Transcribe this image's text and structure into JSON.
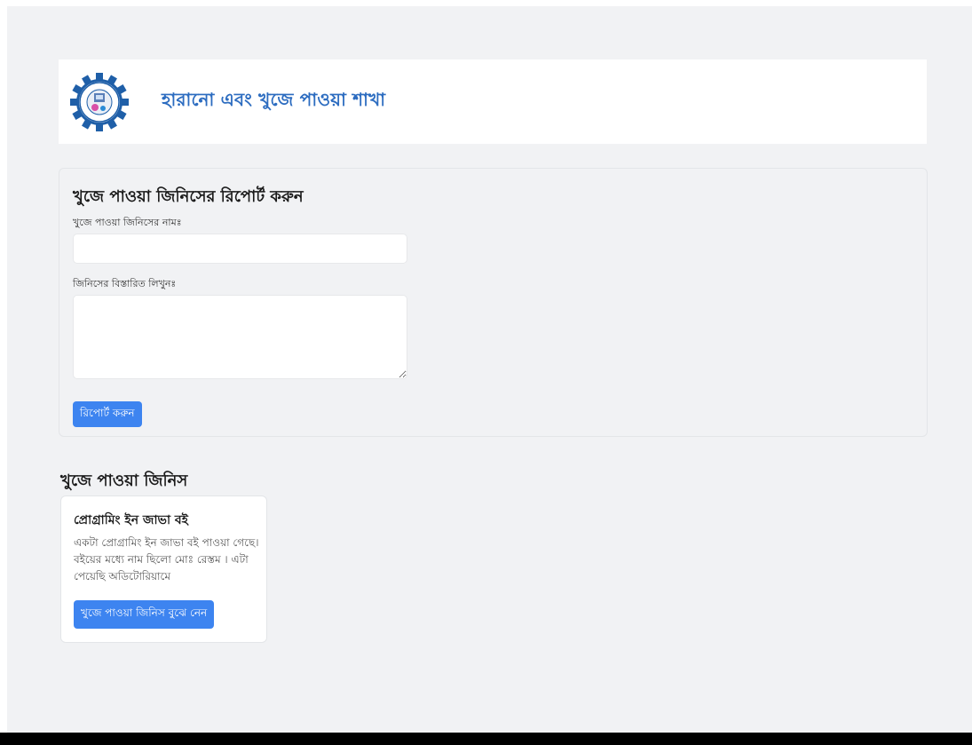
{
  "header": {
    "title": "হারানো এবং খুজে পাওয়া শাখা",
    "logo_icon": "institute-gear-seal-icon"
  },
  "report_form": {
    "title": "খুজে পাওয়া জিনিসের রিপোর্ট করুন",
    "name_label": "খুজে পাওয়া জিনিসের নামঃ",
    "name_value": "",
    "details_label": "জিনিসের বিস্তারিত লিখুনঃ",
    "details_value": "",
    "submit_label": "রিপোর্ট করুন"
  },
  "found_items": {
    "title": "খুজে পাওয়া জিনিস",
    "items": [
      {
        "title": "প্রোগ্রামিং ইন জাভা বই",
        "description": "একটা প্রোগ্রামিং ইন জাভা বই পাওয়া গেছে। বইয়ের মধ্যে নাম ছিলো মোঃ রেস্তম । এটা পেয়েছি অডিটোরিয়ামে",
        "button_label": "খুজে পাওয়া জিনিস বুঝে নেন"
      }
    ]
  },
  "colors": {
    "accent": "#3d84f0",
    "brand_title": "#2c6cc0",
    "page_bg": "#f1f2f4"
  }
}
